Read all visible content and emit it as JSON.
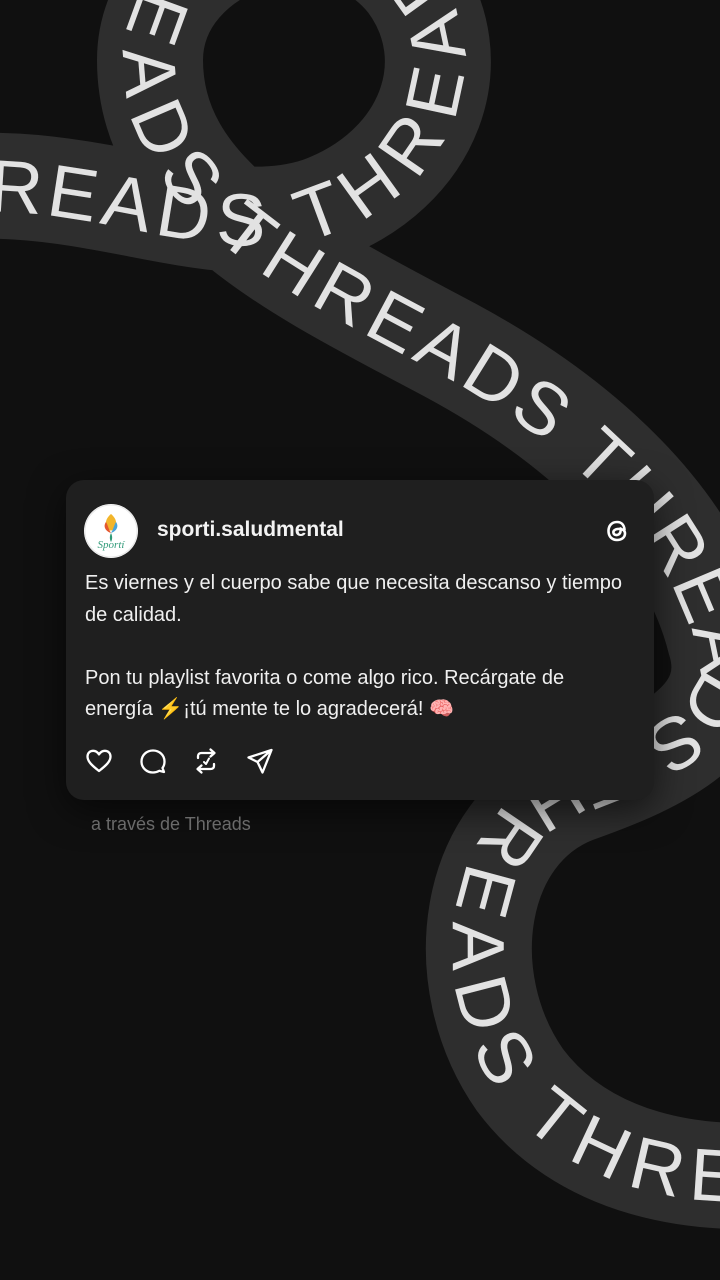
{
  "background": {
    "ribbon_text": "THREADS THREADS THREADS THREADS THREADS THREADS THREADS THREADS",
    "colors": {
      "page": "#101010",
      "ribbon": "#2e2e2e",
      "ribbon_text": "#e2e2e2"
    }
  },
  "post": {
    "avatar_text": "Sportí",
    "username": "sporti.saludmental",
    "paragraph1": "Es viernes y el cuerpo sabe que necesita descanso y tiempo de calidad.",
    "paragraph2": "Pon tu playlist favorita o come algo rico. Recárgate de energía ⚡️¡tú mente te lo agradecerá! 🧠",
    "actions": [
      "heart-icon",
      "comment-icon",
      "repost-icon",
      "share-icon"
    ]
  },
  "via_text": "a través de Threads",
  "colors": {
    "card": "#1f1f1f",
    "text": "#f0f0f0",
    "muted": "#6a6a6a",
    "accent_green": "#2f9a78"
  }
}
